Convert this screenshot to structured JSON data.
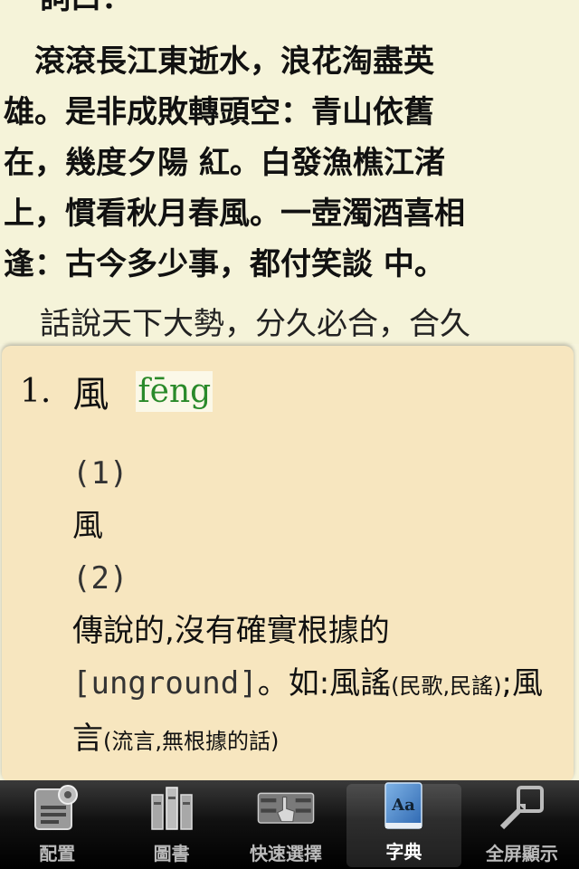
{
  "reader": {
    "top_line": "詞曰：",
    "poem_lines": [
      "　滾滾長江東逝水，浪花淘盡英",
      "雄。是非成敗轉頭空：青山依舊",
      "在，幾度夕陽 紅。白發漁樵江渚",
      "上，慣看秋月春風。一壺濁酒喜相",
      "逢：古今多少事，都付笑談 中。"
    ],
    "next_line": "話說天下大勢，分久必合，合久"
  },
  "dictionary": {
    "entry_number": "1.",
    "character": "風",
    "pinyin": "fēng",
    "definitions": [
      {
        "num": "(1)",
        "text": "風"
      },
      {
        "num": "(2)",
        "text": "傳說的,沒有確實根據的"
      }
    ],
    "continuation": {
      "english": "[unground]",
      "text1": "。如:風謠",
      "paren1": "(民歌,民謠)",
      "text2": ";風言",
      "paren2": "(流言,無根據的話)"
    }
  },
  "tabbar": {
    "tabs": [
      {
        "label": "配置",
        "icon": "settings-icon"
      },
      {
        "label": "圖書",
        "icon": "books-icon"
      },
      {
        "label": "快速選擇",
        "icon": "quick-select-icon"
      },
      {
        "label": "字典",
        "icon": "dictionary-icon",
        "active": true
      },
      {
        "label": "全屏顯示",
        "icon": "fullscreen-icon"
      }
    ]
  }
}
